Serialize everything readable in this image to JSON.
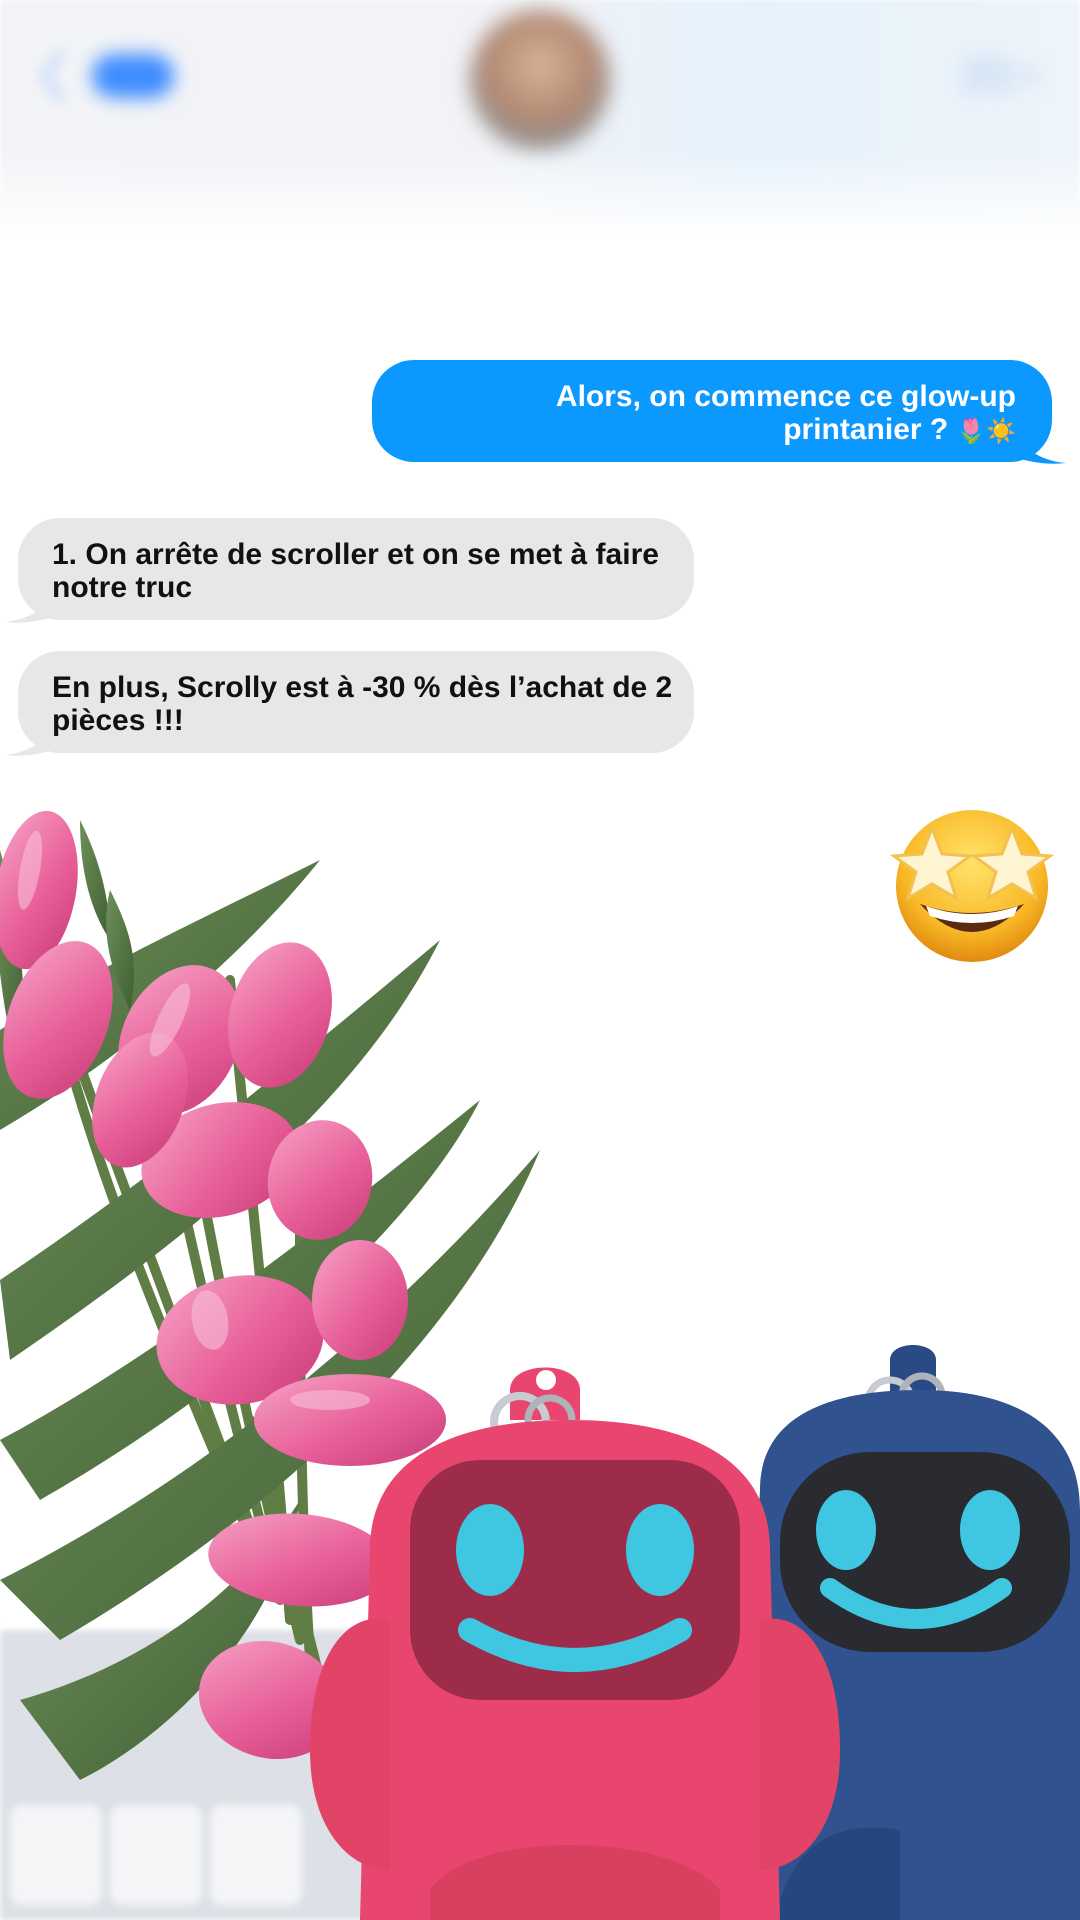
{
  "header": {
    "back_badge": "",
    "contact_name": ""
  },
  "messages": [
    {
      "direction": "outgoing",
      "text": "Alors, on commence ce glow-up printanier ?",
      "emoji": "🌷☀️",
      "color": "#0b99ff"
    },
    {
      "direction": "incoming",
      "text": "1. On arrête de scroller et on se met à faire notre truc",
      "color": "#e7e7e8"
    },
    {
      "direction": "incoming",
      "text": "En plus, Scrolly est à -30 % dès l’achat de 2 pièces !!!",
      "color": "#e7e7e8"
    }
  ],
  "reaction_emoji": "star-struck-emoji",
  "images": {
    "bouquet": "pink-tulips",
    "mascots": [
      "pink-robot-keychain",
      "blue-robot-keychain"
    ]
  },
  "colors": {
    "imessage_blue": "#0b99ff",
    "incoming_gray": "#e7e7e8",
    "tulip_pink": "#e85f98",
    "robot_pink": "#e8466e",
    "robot_blue": "#2f4f8f",
    "robot_face_cyan": "#3fc6e0"
  }
}
